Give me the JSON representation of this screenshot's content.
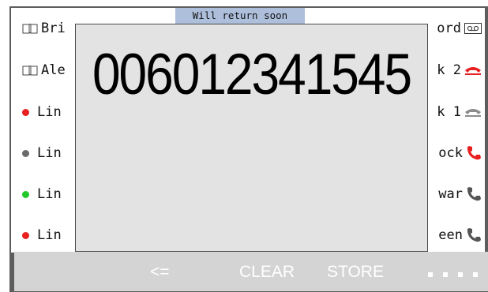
{
  "status_banner": "Will return soon",
  "dial_display": {
    "number": "006012341545"
  },
  "left_column": [
    {
      "type": "contact",
      "icon": "address-book-icon",
      "label": "Bri"
    },
    {
      "type": "contact",
      "icon": "address-book-icon",
      "label": "Ale"
    },
    {
      "type": "line",
      "status_color": "#e82020",
      "label": "Lin"
    },
    {
      "type": "line",
      "status_color": "#6b6b6b",
      "label": "Lin"
    },
    {
      "type": "line",
      "status_color": "#22c82a",
      "label": "Lin"
    },
    {
      "type": "line",
      "status_color": "#e82020",
      "label": "Lin"
    }
  ],
  "right_column": [
    {
      "label": "ord",
      "icon": "voicemail-icon"
    },
    {
      "label": "k 2",
      "icon": "handset-hangup-icon",
      "icon_color": "#e82020"
    },
    {
      "label": "k 1",
      "icon": "handset-hangup-icon",
      "icon_color": "#8c8c8c"
    },
    {
      "label": "ock",
      "icon": "phone-icon",
      "icon_color": "#e82020"
    },
    {
      "label": "war",
      "icon": "phone-icon",
      "icon_color": "#555555"
    },
    {
      "label": "een",
      "icon": "phone-icon",
      "icon_color": "#555555"
    }
  ],
  "softkeys": {
    "backspace": "<=",
    "clear": "CLEAR",
    "store": "STORE",
    "more_icon": "more-dots-icon"
  }
}
